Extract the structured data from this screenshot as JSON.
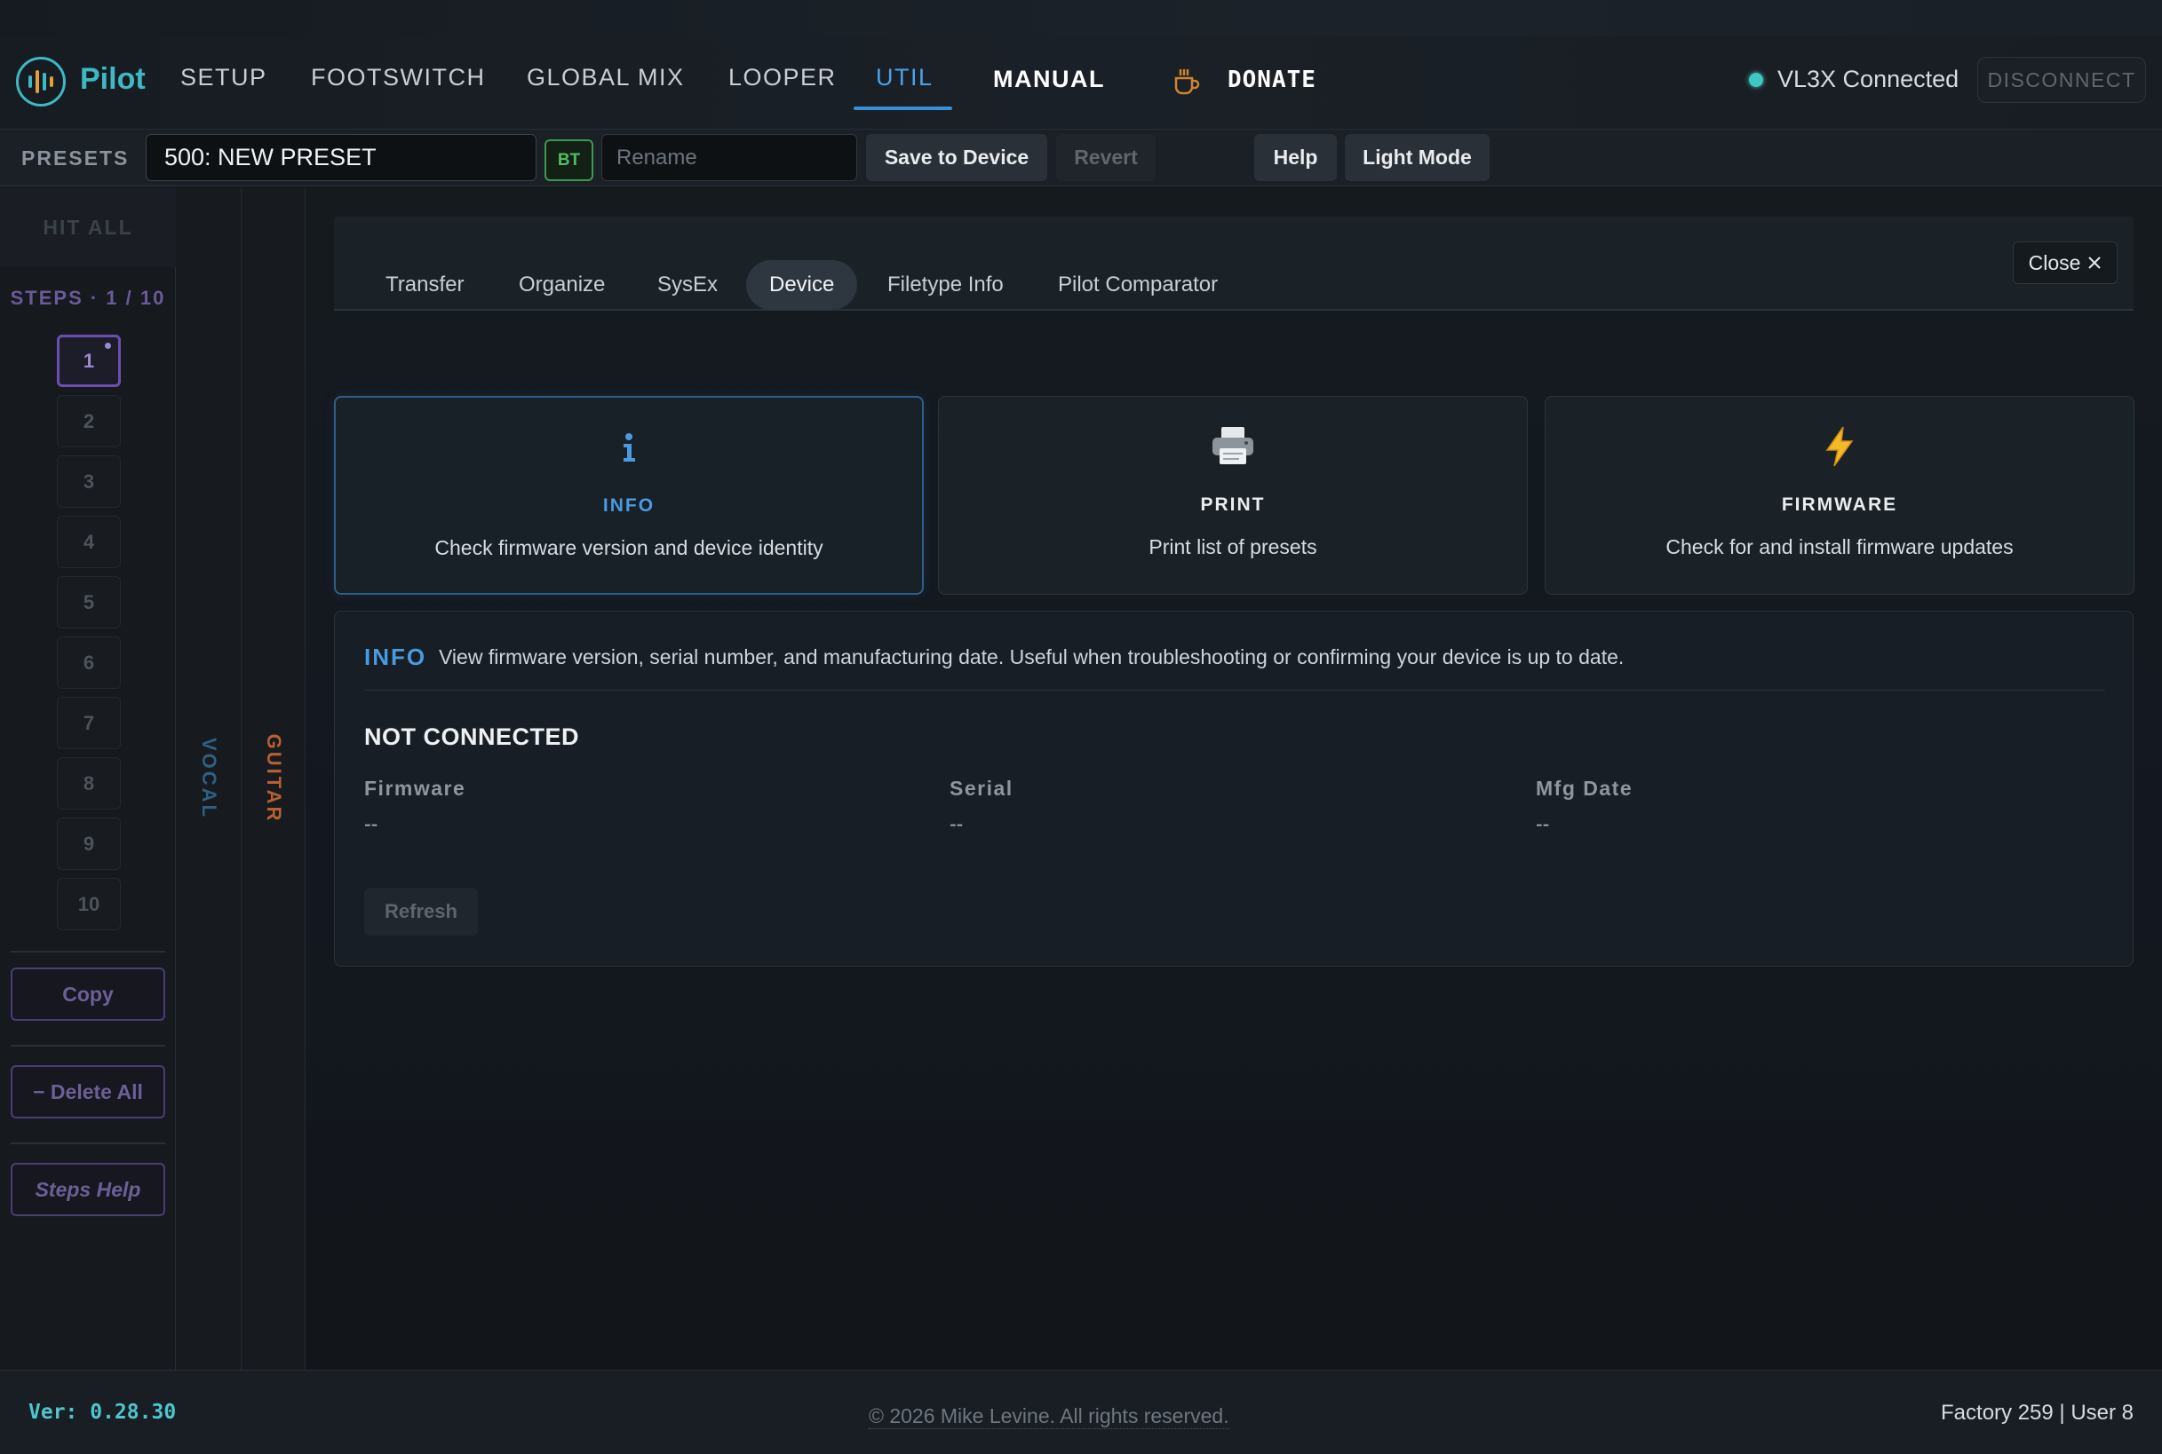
{
  "app": {
    "brand": "Pilot"
  },
  "nav": {
    "items": [
      "SETUP",
      "FOOTSWITCH",
      "GLOBAL MIX",
      "LOOPER",
      "UTIL"
    ],
    "active": "UTIL",
    "manual": "MANUAL",
    "donate": "DONATE",
    "status": "VL3X Connected",
    "status_color": "#3fc7c0",
    "disconnect": "DISCONNECT"
  },
  "presetbar": {
    "label": "PRESETS",
    "preset_name": "500: NEW PRESET",
    "bt_badge": "BT",
    "rename_placeholder": "Rename",
    "save": "Save to Device",
    "revert": "Revert",
    "help": "Help",
    "light_mode": "Light Mode"
  },
  "steps": {
    "hit_all": "HIT ALL",
    "label": "STEPS · 1 / 10",
    "items": [
      "1",
      "2",
      "3",
      "4",
      "5",
      "6",
      "7",
      "8",
      "9",
      "10"
    ],
    "active_index": 0,
    "copy": "Copy",
    "delete_all": "− Delete All",
    "steps_help": "Steps Help"
  },
  "strips": {
    "vocal": "VOCAL",
    "guitar": "GUITAR",
    "vocal_color": "#2f5f80",
    "guitar_color": "#b8602f"
  },
  "util": {
    "tabs": [
      "Transfer",
      "Organize",
      "SysEx",
      "Device",
      "Filetype Info",
      "Pilot Comparator"
    ],
    "active_tab": "Device",
    "close": "Close",
    "cards": [
      {
        "icon": "info-icon",
        "title": "INFO",
        "desc": "Check firmware version and device identity"
      },
      {
        "icon": "printer-icon",
        "title": "PRINT",
        "desc": "Print list of presets"
      },
      {
        "icon": "lightning-icon",
        "title": "FIRMWARE",
        "desc": "Check for and install firmware updates"
      }
    ],
    "info_panel": {
      "tag": "INFO",
      "desc": "View firmware version, serial number, and manufacturing date. Useful when troubleshooting or confirming your device is up to date.",
      "status": "NOT CONNECTED",
      "fields": [
        {
          "label": "Firmware",
          "value": "--"
        },
        {
          "label": "Serial",
          "value": "--"
        },
        {
          "label": "Mfg Date",
          "value": "--"
        }
      ],
      "refresh": "Refresh"
    }
  },
  "footer": {
    "version": "Ver: 0.28.30",
    "copyright": "© 2026 Mike Levine. All rights reserved.",
    "counts": "Factory 259 | User 8"
  }
}
